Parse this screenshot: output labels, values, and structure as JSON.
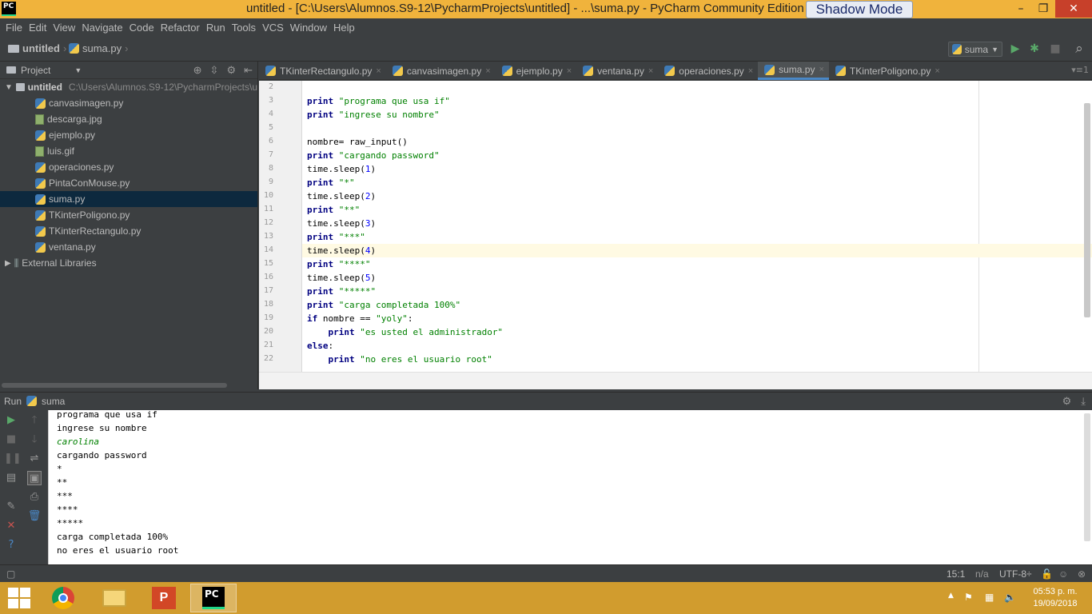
{
  "window": {
    "app_badge": "PC",
    "title": "untitled - [C:\\Users\\Alumnos.S9-12\\PycharmProjects\\untitled] - ...\\suma.py - PyCharm Community Edition 2",
    "shadow_mode": "Shadow Mode",
    "minimize_glyph": "–",
    "maximize_glyph": "❐",
    "close_glyph": "✕"
  },
  "menu": [
    "File",
    "Edit",
    "View",
    "Navigate",
    "Code",
    "Refactor",
    "Run",
    "Tools",
    "VCS",
    "Window",
    "Help"
  ],
  "breadcrumb": {
    "project": "untitled",
    "file": "suma.py"
  },
  "toolbar": {
    "run_config": "suma",
    "run_glyph": "▶",
    "debug_glyph": "✱",
    "stop_glyph": "■",
    "search_glyph": "⌕"
  },
  "project_panel": {
    "title": "Project",
    "root": {
      "name": "untitled",
      "path": "C:\\Users\\Alumnos.S9-12\\PycharmProjects\\u"
    },
    "files": [
      "canvasimagen.py",
      "descarga.jpg",
      "ejemplo.py",
      "luis.gif",
      "operaciones.py",
      "PintaConMouse.py",
      "suma.py",
      "TKinterPoligono.py",
      "TKinterRectangulo.py",
      "ventana.py"
    ],
    "external": "External Libraries"
  },
  "tabs": [
    "TKinterRectangulo.py",
    "canvasimagen.py",
    "ejemplo.py",
    "ventana.py",
    "operaciones.py",
    "suma.py",
    "TKinterPoligono.py"
  ],
  "tab_close": "×",
  "active_tab": "suma.py",
  "line_numbers": [
    "2",
    "3",
    "4",
    "5",
    "6",
    "7",
    "8",
    "9",
    "10",
    "11",
    "12",
    "13",
    "14",
    "15",
    "16",
    "17",
    "18",
    "19",
    "20",
    "21",
    "22"
  ],
  "code": {
    "l3_kw": "print",
    "l3_str": "\"programa que usa if\"",
    "l4_kw": "print",
    "l4_str": "\"ingrese su nombre\"",
    "l6": "nombre= raw_input()",
    "l7_kw": "print",
    "l7_str": "\"cargando password\"",
    "l8_a": "time.sleep(",
    "l8_n": "1",
    "l8_b": ")",
    "l9_kw": "print",
    "l9_str": "\"*\"",
    "l10_a": "time.sleep(",
    "l10_n": "2",
    "l10_b": ")",
    "l11_kw": "print",
    "l11_str": "\"**\"",
    "l12_a": "time.sleep(",
    "l12_n": "3",
    "l12_b": ")",
    "l13_kw": "print",
    "l13_str": "\"***\"",
    "l14_a": "time.sleep(",
    "l14_n": "4",
    "l14_b": ")",
    "l15_kw": "print",
    "l15_str": "\"****\"",
    "l16_a": "time.sleep(",
    "l16_n": "5",
    "l16_b": ")",
    "l17_kw": "print",
    "l17_str": "\"*****\"",
    "l18_kw": "print",
    "l18_str": "\"carga completada 100%\"",
    "l19_kw": "if",
    "l19_mid": " nombre == ",
    "l19_str": "\"yoly\"",
    "l19_end": ":",
    "l20_ind": "    ",
    "l20_kw": "print",
    "l20_str": "\"es usted el administrador\"",
    "l21_kw": "else",
    "l21_end": ":",
    "l22_ind": "    ",
    "l22_kw": "print",
    "l22_str": "\"no eres el usuario root\""
  },
  "run_panel": {
    "label": "Run",
    "config": "suma"
  },
  "console_output": [
    "programa que usa if",
    "ingrese su nombre",
    "carolina",
    "cargando password",
    "*",
    "**",
    "***",
    "****",
    "*****",
    "carga completada 100%",
    "no eres el usuario root"
  ],
  "status": {
    "position": "15:1",
    "separator": "n/a",
    "encoding": "UTF-8÷"
  },
  "taskbar": {
    "time": "05:53 p. m.",
    "date": "19/09/2018",
    "ppt_badge": "P",
    "pc_badge": "PC"
  }
}
